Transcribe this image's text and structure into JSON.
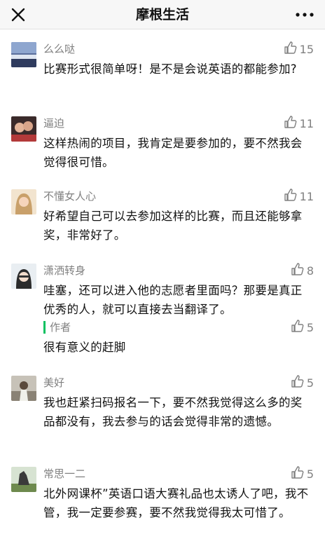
{
  "header": {
    "title": "摩根生活"
  },
  "comments": [
    {
      "name": "么么哒",
      "likes": "15",
      "text": "比赛形式很简单呀！是不是会说英语的都能参加?"
    },
    {
      "name": "逼迫",
      "likes": "11",
      "text": "这样热闹的项目，我肯定是要参加的，要不然我会觉得很可惜。"
    },
    {
      "name": "不懂女人心",
      "likes": "11",
      "text": "好希望自己可以去参加这样的比赛，而且还能够拿奖，非常好了。"
    },
    {
      "name": "潇洒转身",
      "likes": "8",
      "text": "哇塞，还可以进入他的志愿者里面吗？那要是真正优秀的人，就可以直接去当翻译了。",
      "reply": {
        "label": "作者",
        "likes": "5",
        "text": "很有意义的赶脚"
      }
    },
    {
      "name": "美好",
      "likes": "5",
      "text": "我也赶紧扫码报名一下，要不然我觉得这么多的奖品都没有，我去参与的话会觉得非常的遗憾。"
    },
    {
      "name": "常思一二",
      "likes": "5",
      "text": "北外网课杯”英语口语大赛礼品也太诱人了吧，我不管，我一定要参赛，要不然我觉得我太可惜了。"
    }
  ],
  "colors": {
    "accent_green": "#07c160",
    "meta_gray": "#808080"
  }
}
